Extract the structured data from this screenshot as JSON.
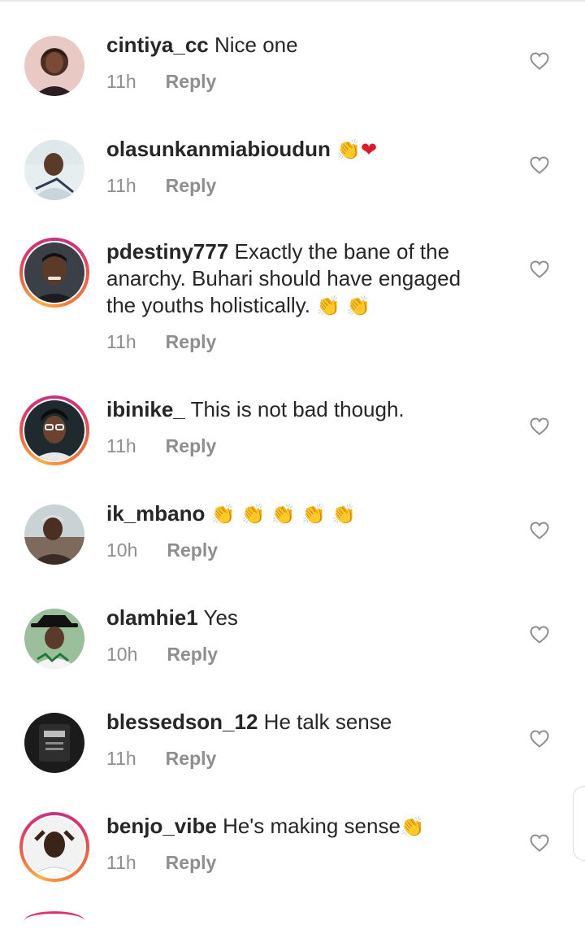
{
  "comments": [
    {
      "username": "cintiya_cc",
      "text": "Nice one",
      "time": "11h",
      "reply": "Reply",
      "story": false
    },
    {
      "username": "olasunkanmiabioudun",
      "text": "",
      "emojis": [
        "clap",
        "heart"
      ],
      "time": "11h",
      "reply": "Reply",
      "story": false
    },
    {
      "username": "pdestiny777",
      "text": "Exactly the bane of the anarchy. Buhari should have engaged the youths holistically.",
      "emojis": [
        "clap",
        "clap"
      ],
      "time": "11h",
      "reply": "Reply",
      "story": true
    },
    {
      "username": "ibinike_",
      "text": "This is not bad though.",
      "time": "11h",
      "reply": "Reply",
      "story": true
    },
    {
      "username": "ik_mbano",
      "text": "",
      "emojis": [
        "clap",
        "clap",
        "clap",
        "clap",
        "clap"
      ],
      "time": "10h",
      "reply": "Reply",
      "story": false
    },
    {
      "username": "olamhie1",
      "text": "Yes",
      "time": "10h",
      "reply": "Reply",
      "story": false
    },
    {
      "username": "blessedson_12",
      "text": "He talk sense",
      "time": "11h",
      "reply": "Reply",
      "story": false
    },
    {
      "username": "benjo_vibe",
      "text": "He's making sense",
      "emojis": [
        "clap"
      ],
      "time": "11h",
      "reply": "Reply",
      "story": true
    }
  ],
  "colors": {
    "text": "#262626",
    "meta": "#8e8e8e",
    "heart_emoji": "#e0182d",
    "clap_emoji": "#f2b21a",
    "story_ring": "#e1306c"
  },
  "icons": {
    "like": "heart-outline-icon",
    "clap": "clapping-hands-emoji",
    "heart": "red-heart-emoji"
  }
}
